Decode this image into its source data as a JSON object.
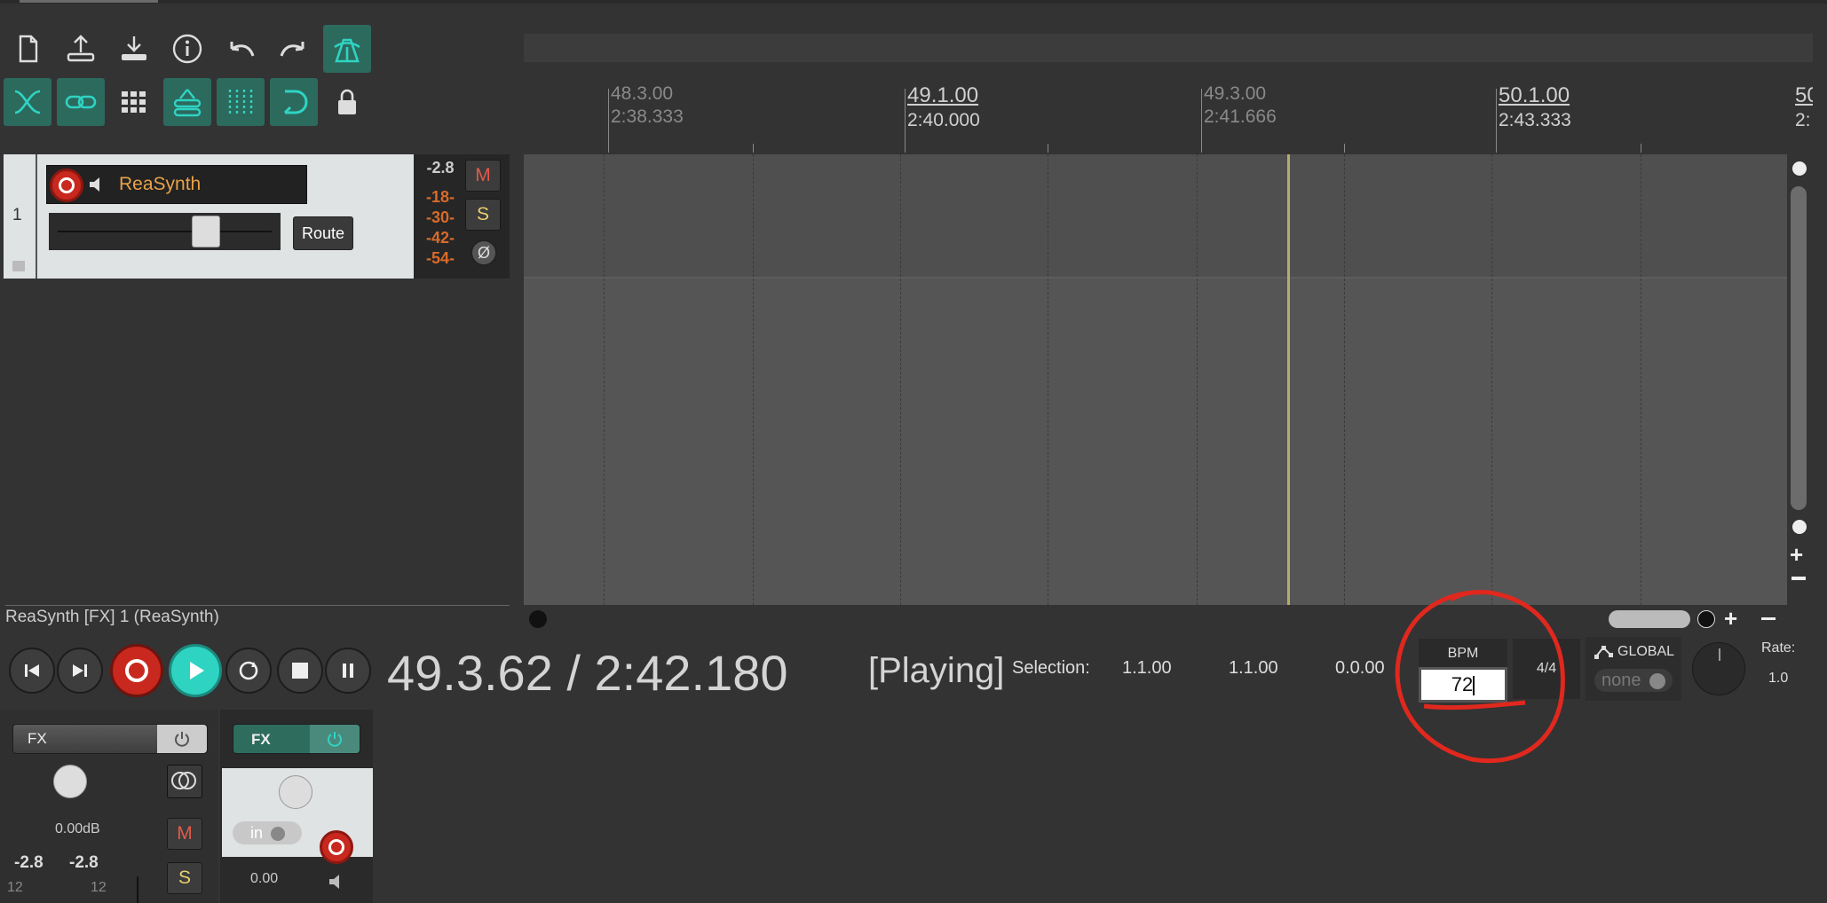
{
  "toolbar": {
    "row1": [
      {
        "name": "new-project-icon",
        "active": false
      },
      {
        "name": "open-project-icon",
        "active": false
      },
      {
        "name": "save-project-icon",
        "active": false
      },
      {
        "name": "project-info-icon",
        "active": false
      },
      {
        "name": "undo-icon",
        "active": false
      },
      {
        "name": "redo-icon",
        "active": false
      },
      {
        "name": "metronome-icon",
        "active": true
      }
    ],
    "row2": [
      {
        "name": "ripple-edit-icon",
        "active": true
      },
      {
        "name": "link-icon",
        "active": true
      },
      {
        "name": "grid-icon",
        "active": false
      },
      {
        "name": "group-icon",
        "active": true
      },
      {
        "name": "snap-grid-icon",
        "active": true
      },
      {
        "name": "loop-icon",
        "active": true
      },
      {
        "name": "lock-icon",
        "active": false
      }
    ]
  },
  "ruler": {
    "marks": [
      {
        "bar": "48.3.00",
        "time": "2:38.333",
        "major": false
      },
      {
        "bar": "49.1.00",
        "time": "2:40.000",
        "major": true
      },
      {
        "bar": "49.3.00",
        "time": "2:41.666",
        "major": false
      },
      {
        "bar": "50.1.00",
        "time": "2:43.333",
        "major": true
      },
      {
        "bar": "50",
        "time": "2:",
        "major": true
      }
    ]
  },
  "track": {
    "number": "1",
    "name": "ReaSynth",
    "route_label": "Route",
    "meter_peak": "-2.8",
    "meter_scale": [
      "-18-",
      "-30-",
      "-42-",
      "-54-"
    ],
    "mute_label": "M",
    "solo_label": "S",
    "phase_label": "Ø"
  },
  "fx_window_title": "ReaSynth [FX] 1 (ReaSynth)",
  "transport": {
    "position": "49.3.62 / 2:42.180",
    "state": "[Playing]",
    "selection_label": "Selection:",
    "selection_start": "1.1.00",
    "selection_end": "1.1.00",
    "selection_length": "0.0.00",
    "bpm_label": "BPM",
    "bpm_value": "72",
    "time_signature": "4/4",
    "global_label": "GLOBAL",
    "global_value": "none",
    "rate_label": "Rate:",
    "rate_value": "1.0"
  },
  "mixer": {
    "master": {
      "fx_label": "FX",
      "volume": "0.00dB",
      "peak_left": "-2.8",
      "peak_right": "-2.8",
      "scale_left": "12",
      "scale_right": "12",
      "mute_label": "M",
      "solo_label": "S"
    },
    "track1": {
      "fx_label": "FX",
      "input": "in",
      "volume": "0.00"
    }
  },
  "colors": {
    "accent": "#2fd3c2",
    "record": "#c8281e",
    "track_name": "#e8a24a",
    "meter": "#d96a2a",
    "annotation": "#e0281e"
  }
}
